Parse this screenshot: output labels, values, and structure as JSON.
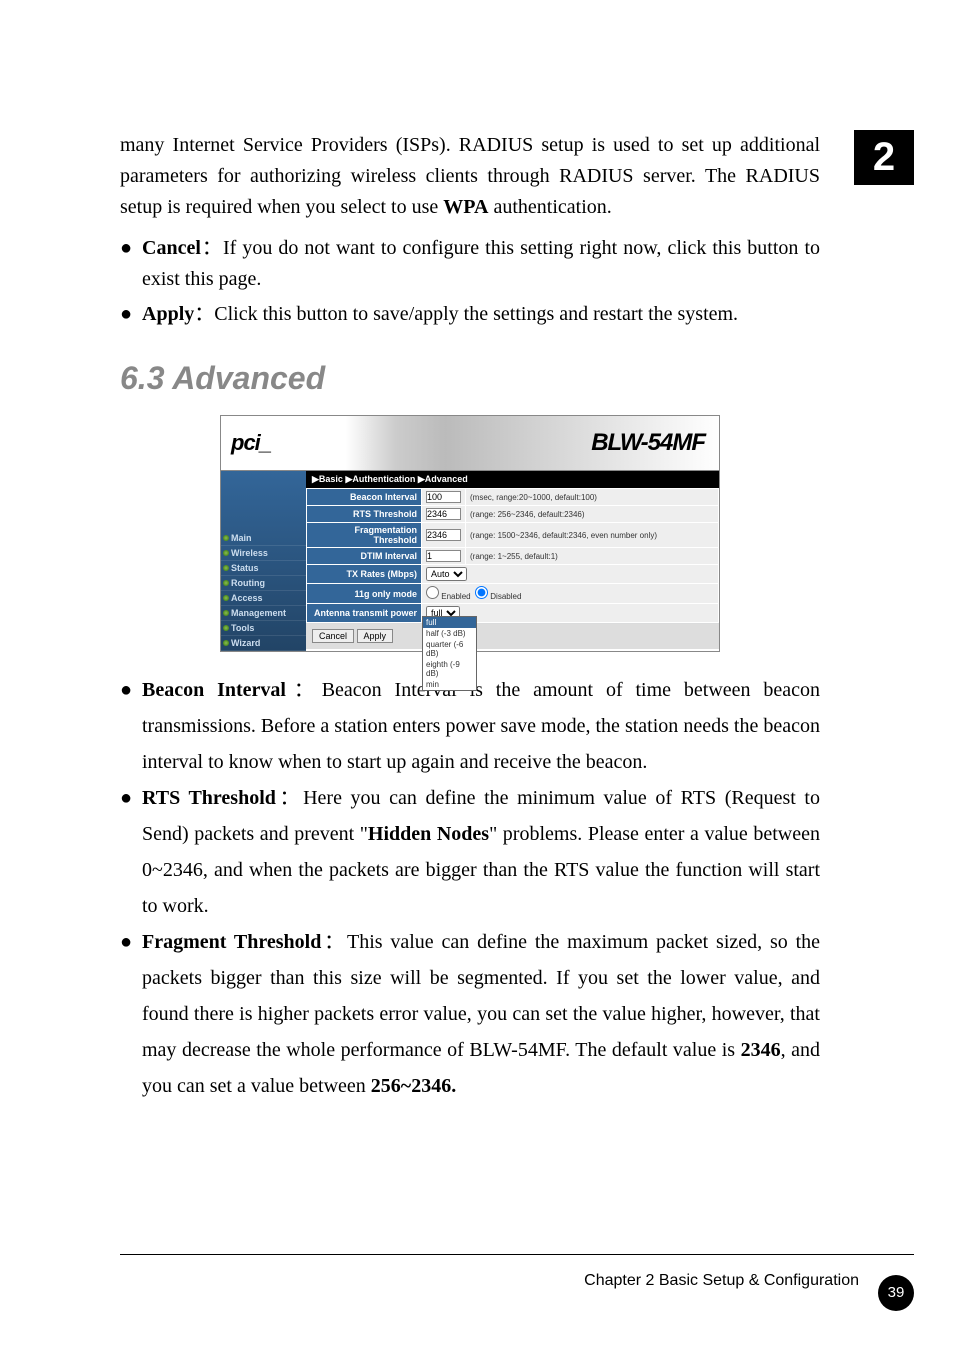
{
  "chapterBox": "2",
  "topParagraph": "many Internet Service Providers (ISPs). RADIUS setup is used to set up additional parameters for authorizing wireless clients through RADIUS server. The RADIUS setup is required when you select to use ",
  "topParagraphBold": "WPA",
  "topParagraphEnd": " authentication.",
  "cancelLabel": "Cancel",
  "cancelSep": "：",
  "cancelText": "If you do not want to configure this setting right now, click this button to exist this page.",
  "applyLabel": "Apply",
  "applySep": "：",
  "applyText": "Click this button to save/apply the settings and restart the system.",
  "sectionTitle": "6.3 Advanced",
  "screenshot": {
    "logo": "pci_",
    "model": "BLW-54MF",
    "tabs": "▶Basic  ▶Authentication  ▶Advanced",
    "nav": [
      "Main",
      "Wireless",
      "Status",
      "Routing",
      "Access",
      "Management",
      "Tools",
      "Wizard"
    ],
    "rows": [
      {
        "label": "Beacon Interval",
        "value": "100",
        "hint": "(msec, range:20~1000, default:100)"
      },
      {
        "label": "RTS Threshold",
        "value": "2346",
        "hint": "(range: 256~2346, default:2346)"
      },
      {
        "label": "Fragmentation Threshold",
        "value": "2346",
        "hint": "(range: 1500~2346, default:2346, even number only)"
      },
      {
        "label": "DTIM Interval",
        "value": "1",
        "hint": "(range: 1~255, default:1)"
      },
      {
        "label": "TX Rates (Mbps)",
        "select": "Auto"
      },
      {
        "label": "11g only mode",
        "radio1": "Enabled",
        "radio2": "Disabled"
      },
      {
        "label": "Antenna transmit power",
        "select": "full"
      }
    ],
    "dropdownOptions": [
      "full",
      "half (-3 dB)",
      "quarter (-6 dB)",
      "eighth (-9 dB)",
      "min"
    ],
    "buttons": {
      "cancel": "Cancel",
      "apply": "Apply"
    }
  },
  "beaconLabel": "Beacon Interval",
  "beaconSep": "：",
  "beaconText": "Beacon Interval is the amount of time between beacon transmissions. Before a station enters power save mode, the station needs the beacon interval to know when to start up again and receive the beacon.",
  "rtsLabel": "RTS Threshold",
  "rtsSep": "：",
  "rtsText1": "Here you can define the minimum value of RTS (Request to Send) packets and prevent \"",
  "rtsBold": "Hidden Nodes",
  "rtsText2": "\" problems. Please enter a value between 0~2346, and when the packets are bigger than the RTS value the function will start to work.",
  "fragLabel": "Fragment Threshold",
  "fragSep": "：",
  "fragText1": "This value can define the maximum packet sized, so the packets bigger than this size will be segmented. If you set the lower value, and found there is higher packets error value, you can set the value higher, however, that may decrease the whole performance of BLW-54MF. The default value is ",
  "fragBold1": "2346",
  "fragText2": ", and you can set a value between ",
  "fragBold2": "256~2346.",
  "footerText": "Chapter 2 Basic Setup & Configuration",
  "footerPage": "39"
}
